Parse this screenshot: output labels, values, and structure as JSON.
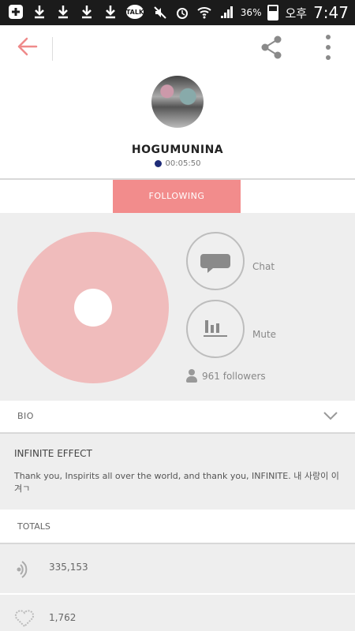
{
  "status_bar": {
    "battery": "36%",
    "ampm": "오후",
    "time": "7:47",
    "notification_badge": "TALK"
  },
  "app_bar": {
    "back_icon": "arrow-left-icon",
    "share_icon": "share-icon",
    "more_icon": "more-vertical-icon"
  },
  "profile": {
    "name": "HOGUMUNINA",
    "timer": "00:05:50",
    "live_dot_color": "#1f2c78"
  },
  "follow_button": {
    "label": "FOLLOWING",
    "color": "#f28c8c"
  },
  "actions": {
    "chat_label": "Chat",
    "mute_label": "Mute",
    "followers_text": "961 followers"
  },
  "bio": {
    "section_title": "BIO",
    "heading": "INFINITE EFFECT",
    "text": "Thank you, Inspirits all over the world, and thank you, INFINITE. 내 사랑이 이겨ㄱ"
  },
  "totals": {
    "section_title": "TOTALS",
    "listens": "335,153",
    "hearts": "1,762"
  },
  "colors": {
    "accent": "#f28c8c",
    "disc": "#f0bcbc"
  }
}
